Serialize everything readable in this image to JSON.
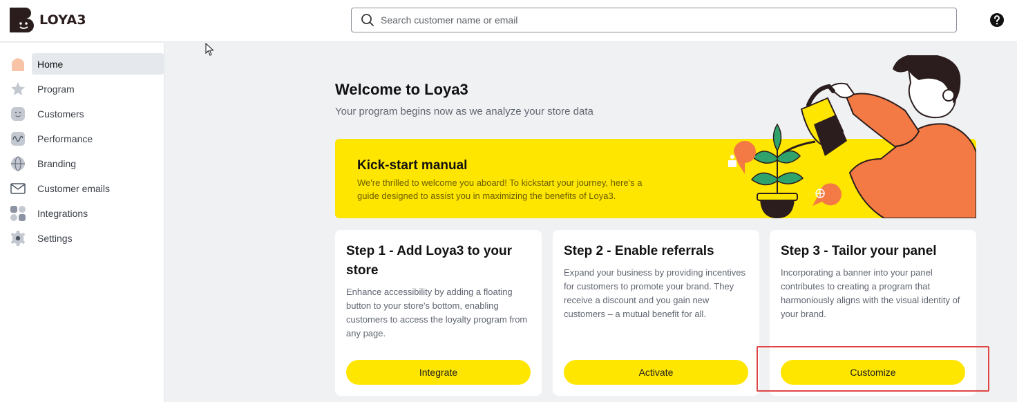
{
  "app": {
    "name": "LOYA3"
  },
  "search": {
    "placeholder": "Search customer name or email"
  },
  "sidebar": {
    "items": [
      {
        "label": "Home",
        "icon": "home-icon",
        "active": true
      },
      {
        "label": "Program",
        "icon": "star-icon"
      },
      {
        "label": "Customers",
        "icon": "customers-icon"
      },
      {
        "label": "Performance",
        "icon": "performance-icon"
      },
      {
        "label": "Branding",
        "icon": "globe-icon"
      },
      {
        "label": "Customer emails",
        "icon": "envelope-icon"
      },
      {
        "label": "Integrations",
        "icon": "integrations-icon"
      },
      {
        "label": "Settings",
        "icon": "gear-icon"
      }
    ]
  },
  "main": {
    "title": "Welcome to Loya3",
    "subtitle": "Your program begins now as we analyze your store data",
    "banner": {
      "title": "Kick-start manual",
      "text": "We're thrilled to welcome you aboard! To kickstart your journey, here's a guide designed to assist you in maximizing the benefits of Loya3."
    },
    "steps": [
      {
        "title": "Step 1 - Add Loya3 to your store",
        "text": "Enhance accessibility by adding a floating button to your store's bottom, enabling customers to access the loyalty program from any page.",
        "button": "Integrate"
      },
      {
        "title": "Step 2 - Enable referrals",
        "text": "Expand your business by providing incentives for customers to promote your brand. They receive a discount and you gain new customers – a mutual benefit for all.",
        "button": "Activate"
      },
      {
        "title": "Step 3 - Tailor your panel",
        "text": "Incorporating a banner into your panel contributes to creating a program that harmoniously aligns with the visual identity of your brand.",
        "button": "Customize"
      }
    ]
  },
  "colors": {
    "brand_yellow": "#ffe600",
    "brand_dark": "#2b1d1d",
    "highlight_red": "#e04444",
    "accent_orange": "#f47a45"
  }
}
